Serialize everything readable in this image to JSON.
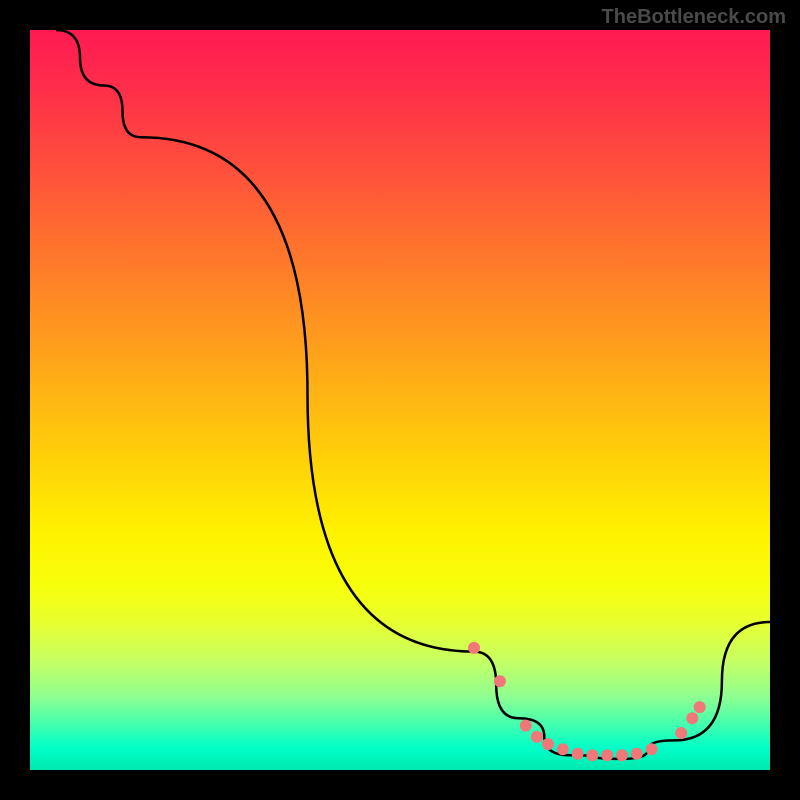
{
  "watermark": "TheBottleneck.com",
  "chart_data": {
    "type": "line",
    "title": "",
    "xlabel": "",
    "ylabel": "",
    "xlim": [
      0,
      100
    ],
    "ylim": [
      0,
      100
    ],
    "series": [
      {
        "name": "curve",
        "points": [
          {
            "x": 3.5,
            "y": 100
          },
          {
            "x": 10,
            "y": 92.5
          },
          {
            "x": 15,
            "y": 85.5
          },
          {
            "x": 60,
            "y": 16
          },
          {
            "x": 66,
            "y": 7
          },
          {
            "x": 73,
            "y": 2
          },
          {
            "x": 80,
            "y": 1.5
          },
          {
            "x": 87,
            "y": 4
          },
          {
            "x": 100,
            "y": 20
          }
        ]
      }
    ],
    "markers": [
      {
        "x": 60,
        "y": 16.5
      },
      {
        "x": 63.5,
        "y": 12
      },
      {
        "x": 67,
        "y": 6
      },
      {
        "x": 68.5,
        "y": 4.5
      },
      {
        "x": 70,
        "y": 3.5
      },
      {
        "x": 72,
        "y": 2.8
      },
      {
        "x": 74,
        "y": 2.2
      },
      {
        "x": 76,
        "y": 2
      },
      {
        "x": 78,
        "y": 2
      },
      {
        "x": 80,
        "y": 2
      },
      {
        "x": 82,
        "y": 2.2
      },
      {
        "x": 84,
        "y": 2.8
      },
      {
        "x": 88,
        "y": 5
      },
      {
        "x": 89.5,
        "y": 7
      },
      {
        "x": 90.5,
        "y": 8.5
      }
    ],
    "marker_color": "#f07878",
    "line_color": "#000000",
    "gradient_stops": [
      {
        "pos": 0,
        "color": "#ff1a52"
      },
      {
        "pos": 50,
        "color": "#ffd108"
      },
      {
        "pos": 75,
        "color": "#f8ff0a"
      },
      {
        "pos": 95,
        "color": "#40ffb0"
      },
      {
        "pos": 100,
        "color": "#00e8b0"
      }
    ]
  }
}
